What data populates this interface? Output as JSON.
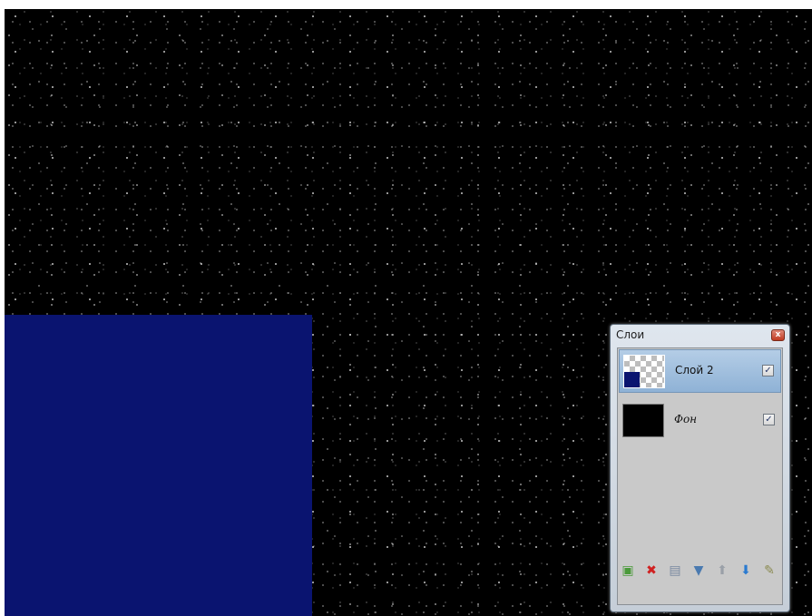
{
  "colors": {
    "canvas_background": "#000000",
    "blue_layer": "#0a1470",
    "selection": "#9fbfe0"
  },
  "layers_panel": {
    "title": "Слои",
    "close_glyph": "x",
    "layers": [
      {
        "name": "Слой 2",
        "visible": true,
        "selected": true,
        "thumbnail": "transparent-with-blue"
      },
      {
        "name": "Фон",
        "visible": true,
        "selected": false,
        "thumbnail": "black"
      }
    ],
    "checkbox_glyph": "✓",
    "toolbar": [
      {
        "icon": "add-layer-icon",
        "glyph": "▣",
        "color": "#4a9a3a"
      },
      {
        "icon": "delete-layer-icon",
        "glyph": "✖",
        "color": "#d02020"
      },
      {
        "icon": "duplicate-layer-icon",
        "glyph": "▤",
        "color": "#7a8aa0"
      },
      {
        "icon": "merge-layer-down-icon",
        "glyph": "▼",
        "color": "#4a7ab0"
      },
      {
        "icon": "move-layer-up-icon",
        "glyph": "⬆",
        "color": "#9aa0a8"
      },
      {
        "icon": "move-layer-down-icon",
        "glyph": "⬇",
        "color": "#2a7ad0"
      },
      {
        "icon": "layer-properties-icon",
        "glyph": "✎",
        "color": "#8a8a50"
      }
    ]
  }
}
